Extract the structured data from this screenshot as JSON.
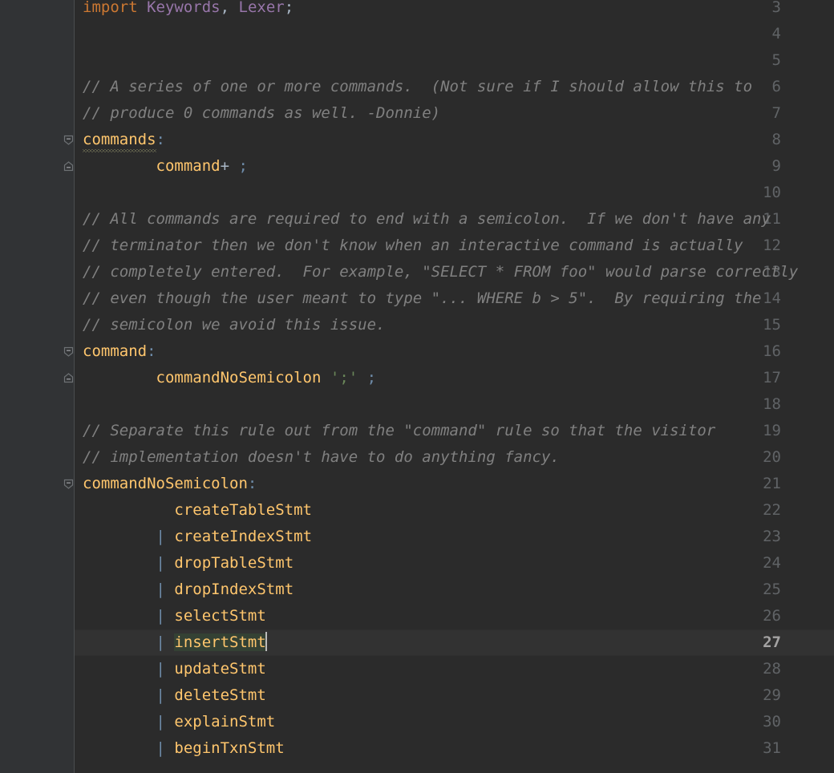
{
  "editor": {
    "theme_name": "darcula",
    "colors": {
      "editor_background": "#2b2b2b",
      "gutter_background": "#313335",
      "caret_line_background": "#323232",
      "line_number": "#606366",
      "caret_line_number": "#a4a3a3",
      "keyword": "#cc7832",
      "identifier": "#9876aa",
      "comment": "#808080",
      "rule_name": "#ffc66d",
      "string": "#6a8759",
      "pipe": "#6e8ba8",
      "default_text": "#a9b7c6",
      "identifier_highlight": "#344134",
      "caret": "#bbbbbb",
      "squiggle": "#9a9a6e"
    },
    "first_visible_line": 3,
    "caret_line": 27,
    "caret_column": 23
  },
  "gutter": {
    "line_numbers": [
      "3",
      "4",
      "5",
      "6",
      "7",
      "8",
      "9",
      "10",
      "11",
      "12",
      "13",
      "14",
      "15",
      "16",
      "17",
      "18",
      "19",
      "20",
      "21",
      "22",
      "23",
      "24",
      "25",
      "26",
      "27",
      "28",
      "29",
      "30",
      "31"
    ],
    "fold_markers": [
      {
        "line": 8,
        "type": "fold-region-start",
        "glyph": "minus-pentagon-down"
      },
      {
        "line": 9,
        "type": "fold-region-end",
        "glyph": "minus-pentagon-up"
      },
      {
        "line": 16,
        "type": "fold-region-start",
        "glyph": "minus-pentagon-down"
      },
      {
        "line": 17,
        "type": "fold-region-end",
        "glyph": "minus-pentagon-up"
      },
      {
        "line": 21,
        "type": "fold-region-start",
        "glyph": "minus-pentagon-down"
      }
    ]
  },
  "code_lines": [
    {
      "n": "3",
      "indent": 0,
      "tokens": [
        {
          "t": "kw",
          "v": "import"
        },
        {
          "t": "plain",
          "v": " "
        },
        {
          "t": "ident",
          "v": "Keywords"
        },
        {
          "t": "punct",
          "v": ","
        },
        {
          "t": "plain",
          "v": " "
        },
        {
          "t": "ident",
          "v": "Lexer"
        },
        {
          "t": "punct",
          "v": ";"
        }
      ]
    },
    {
      "n": "4",
      "indent": 0,
      "tokens": []
    },
    {
      "n": "5",
      "indent": 0,
      "tokens": []
    },
    {
      "n": "6",
      "indent": 0,
      "tokens": [
        {
          "t": "comment",
          "v": "// A series of one or more commands.  (Not sure if I should allow this to"
        }
      ]
    },
    {
      "n": "7",
      "indent": 0,
      "tokens": [
        {
          "t": "comment",
          "v": "// produce 0 commands as well. -Donnie)"
        }
      ]
    },
    {
      "n": "8",
      "indent": 0,
      "tokens": [
        {
          "t": "rule",
          "v": "commands",
          "squiggle": true
        },
        {
          "t": "colon",
          "v": ":"
        }
      ]
    },
    {
      "n": "9",
      "indent": 0,
      "tokens": [
        {
          "t": "plain",
          "v": "        "
        },
        {
          "t": "ref",
          "v": "command"
        },
        {
          "t": "plain",
          "v": "+ "
        },
        {
          "t": "semi",
          "v": ";"
        }
      ]
    },
    {
      "n": "10",
      "indent": 0,
      "tokens": []
    },
    {
      "n": "11",
      "indent": 0,
      "tokens": [
        {
          "t": "comment",
          "v": "// All commands are required to end with a semicolon.  If we don't have any"
        }
      ]
    },
    {
      "n": "12",
      "indent": 0,
      "tokens": [
        {
          "t": "comment",
          "v": "// terminator then we don't know when an interactive command is actually"
        }
      ]
    },
    {
      "n": "13",
      "indent": 0,
      "tokens": [
        {
          "t": "comment",
          "v": "// completely entered.  For example, \"SELECT * FROM foo\" would parse correctly"
        }
      ]
    },
    {
      "n": "14",
      "indent": 0,
      "tokens": [
        {
          "t": "comment",
          "v": "// even though the user meant to type \"... WHERE b > 5\".  By requiring the"
        }
      ]
    },
    {
      "n": "15",
      "indent": 0,
      "tokens": [
        {
          "t": "comment",
          "v": "// semicolon we avoid this issue."
        }
      ]
    },
    {
      "n": "16",
      "indent": 0,
      "tokens": [
        {
          "t": "rule",
          "v": "command"
        },
        {
          "t": "colon",
          "v": ":"
        }
      ]
    },
    {
      "n": "17",
      "indent": 0,
      "tokens": [
        {
          "t": "plain",
          "v": "        "
        },
        {
          "t": "ref",
          "v": "commandNoSemicolon"
        },
        {
          "t": "plain",
          "v": " "
        },
        {
          "t": "string",
          "v": "';'"
        },
        {
          "t": "plain",
          "v": " "
        },
        {
          "t": "semi",
          "v": ";"
        }
      ]
    },
    {
      "n": "18",
      "indent": 0,
      "tokens": []
    },
    {
      "n": "19",
      "indent": 0,
      "tokens": [
        {
          "t": "comment",
          "v": "// Separate this rule out from the \"command\" rule so that the visitor"
        }
      ]
    },
    {
      "n": "20",
      "indent": 0,
      "tokens": [
        {
          "t": "comment",
          "v": "// implementation doesn't have to do anything fancy."
        }
      ]
    },
    {
      "n": "21",
      "indent": 0,
      "tokens": [
        {
          "t": "rule",
          "v": "commandNoSemicolon"
        },
        {
          "t": "colon",
          "v": ":"
        }
      ]
    },
    {
      "n": "22",
      "indent": 0,
      "tokens": [
        {
          "t": "plain",
          "v": "          "
        },
        {
          "t": "ref",
          "v": "createTableStmt"
        }
      ]
    },
    {
      "n": "23",
      "indent": 0,
      "tokens": [
        {
          "t": "plain",
          "v": "        "
        },
        {
          "t": "pipe",
          "v": "|"
        },
        {
          "t": "plain",
          "v": " "
        },
        {
          "t": "ref",
          "v": "createIndexStmt"
        }
      ]
    },
    {
      "n": "24",
      "indent": 0,
      "tokens": [
        {
          "t": "plain",
          "v": "        "
        },
        {
          "t": "pipe",
          "v": "|"
        },
        {
          "t": "plain",
          "v": " "
        },
        {
          "t": "ref",
          "v": "dropTableStmt"
        }
      ]
    },
    {
      "n": "25",
      "indent": 0,
      "tokens": [
        {
          "t": "plain",
          "v": "        "
        },
        {
          "t": "pipe",
          "v": "|"
        },
        {
          "t": "plain",
          "v": " "
        },
        {
          "t": "ref",
          "v": "dropIndexStmt"
        }
      ]
    },
    {
      "n": "26",
      "indent": 0,
      "tokens": [
        {
          "t": "plain",
          "v": "        "
        },
        {
          "t": "pipe",
          "v": "|"
        },
        {
          "t": "plain",
          "v": " "
        },
        {
          "t": "ref",
          "v": "selectStmt"
        }
      ]
    },
    {
      "n": "27",
      "indent": 0,
      "caret_line": true,
      "tokens": [
        {
          "t": "plain",
          "v": "        "
        },
        {
          "t": "pipe",
          "v": "|"
        },
        {
          "t": "plain",
          "v": " "
        },
        {
          "t": "ref",
          "v": "insertStmt",
          "highlight": true
        },
        {
          "t": "caret",
          "v": ""
        }
      ]
    },
    {
      "n": "28",
      "indent": 0,
      "tokens": [
        {
          "t": "plain",
          "v": "        "
        },
        {
          "t": "pipe",
          "v": "|"
        },
        {
          "t": "plain",
          "v": " "
        },
        {
          "t": "ref",
          "v": "updateStmt"
        }
      ]
    },
    {
      "n": "29",
      "indent": 0,
      "tokens": [
        {
          "t": "plain",
          "v": "        "
        },
        {
          "t": "pipe",
          "v": "|"
        },
        {
          "t": "plain",
          "v": " "
        },
        {
          "t": "ref",
          "v": "deleteStmt"
        }
      ]
    },
    {
      "n": "30",
      "indent": 0,
      "tokens": [
        {
          "t": "plain",
          "v": "        "
        },
        {
          "t": "pipe",
          "v": "|"
        },
        {
          "t": "plain",
          "v": " "
        },
        {
          "t": "ref",
          "v": "explainStmt"
        }
      ]
    },
    {
      "n": "31",
      "indent": 0,
      "tokens": [
        {
          "t": "plain",
          "v": "        "
        },
        {
          "t": "pipe",
          "v": "|"
        },
        {
          "t": "plain",
          "v": " "
        },
        {
          "t": "ref",
          "v": "beginTxnStmt"
        }
      ]
    }
  ]
}
